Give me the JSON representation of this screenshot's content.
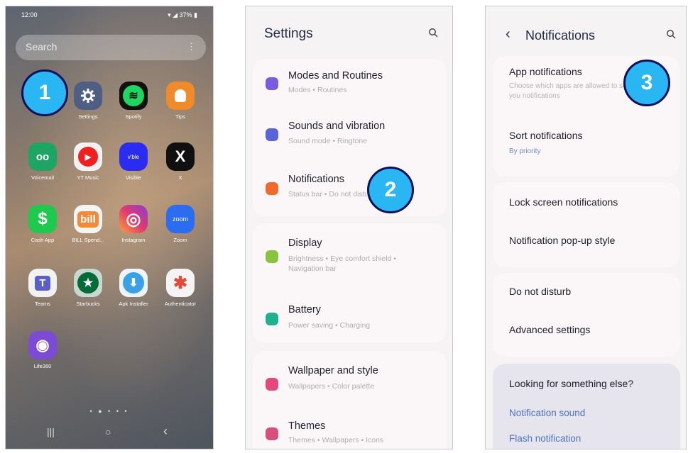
{
  "home": {
    "status_time": "12:00",
    "status_right": "▾ ◢ 37% ▮",
    "search_placeholder": "Search",
    "search_menu": "⋮",
    "apps": [
      {
        "label": "",
        "color": "#3b6fd6"
      },
      {
        "label": "Settings",
        "color": "#5d6b8a",
        "icon": "gear-icon"
      },
      {
        "label": "Spotify",
        "color": "#111111",
        "icon": "spotify-icon"
      },
      {
        "label": "Tips",
        "color": "#f08b2c",
        "icon": "lightbulb-icon"
      },
      {
        "label": "Voicemail",
        "color": "#1ea464",
        "icon": "voicemail-icon"
      },
      {
        "label": "YT Music",
        "color": "#f2f2f2",
        "icon": "yt-music-icon"
      },
      {
        "label": "Visible",
        "color": "#2a2cf0",
        "icon": "visible-icon"
      },
      {
        "label": "X",
        "color": "#101010",
        "icon": "x-logo-icon"
      },
      {
        "label": "Cash App",
        "color": "#1fc94e",
        "icon": "dollar-icon"
      },
      {
        "label": "BILL Spend...",
        "color": "#f4f4f4",
        "icon": "bill-icon"
      },
      {
        "label": "Instagram",
        "color": "#d62f78",
        "icon": "instagram-icon"
      },
      {
        "label": "Zoom",
        "color": "#2b6cf0",
        "icon": "zoom-icon"
      },
      {
        "label": "Teams",
        "color": "#f2f2f2",
        "icon": "teams-icon"
      },
      {
        "label": "Starbucks",
        "color": "#c9d8cf",
        "icon": "starbucks-icon"
      },
      {
        "label": "Apk Installer",
        "color": "#eef4fb",
        "icon": "download-icon"
      },
      {
        "label": "Authenticator",
        "color": "#f4f4f4",
        "icon": "authenticator-icon"
      },
      {
        "label": "Life360",
        "color": "#7b4bd6",
        "icon": "fingerprint-icon"
      }
    ],
    "page_dots": "• ● • • •",
    "nav": {
      "recents": "|||",
      "home": "○",
      "back": "‹"
    }
  },
  "icon_glyphs": {
    "spotify": "≋",
    "yt": "▶",
    "visible": "v'ble",
    "x": "X",
    "cash": "$",
    "bill": "bill",
    "insta": "◎",
    "zoom": "zoom",
    "teams": "T",
    "starbucks": "★",
    "apk": "⬇",
    "auth": "✱",
    "life": "◉",
    "vm": "oo"
  },
  "badges": {
    "one": "1",
    "two": "2",
    "three": "3"
  },
  "settings": {
    "title": "Settings",
    "items": [
      {
        "title": "Modes and Routines",
        "subtitle": "Modes • Routines",
        "color": "#7a5ce0"
      },
      {
        "title": "Sounds and vibration",
        "subtitle": "Sound mode • Ringtone",
        "color": "#5a63d9"
      },
      {
        "title": "Notifications",
        "subtitle": "Status bar • Do not disturb",
        "color": "#f06a2c"
      },
      {
        "title": "Display",
        "subtitle": "Brightness • Eye comfort shield •",
        "subtitle2": "Navigation bar",
        "color": "#8ac43e"
      },
      {
        "title": "Battery",
        "subtitle": "Power saving • Charging",
        "color": "#1fb08e"
      },
      {
        "title": "Wallpaper and style",
        "subtitle": "Wallpapers • Color palette",
        "color": "#e2487a"
      },
      {
        "title": "Themes",
        "subtitle": "Themes • Wallpapers • Icons",
        "color": "#d94f7c"
      }
    ]
  },
  "notifications": {
    "back": "‹",
    "title": "Notifications",
    "app_notifications": "App notifications",
    "app_notifications_sub": "Choose which apps are allowed to send",
    "app_notifications_sub2": "you notifications",
    "sort": "Sort notifications",
    "sort_sub": "By priority",
    "lock": "Lock screen notifications",
    "popup": "Notification pop-up style",
    "dnd": "Do not disturb",
    "advanced": "Advanced settings",
    "looking": "Looking for something else?",
    "link1": "Notification sound",
    "link2": "Flash notification"
  }
}
